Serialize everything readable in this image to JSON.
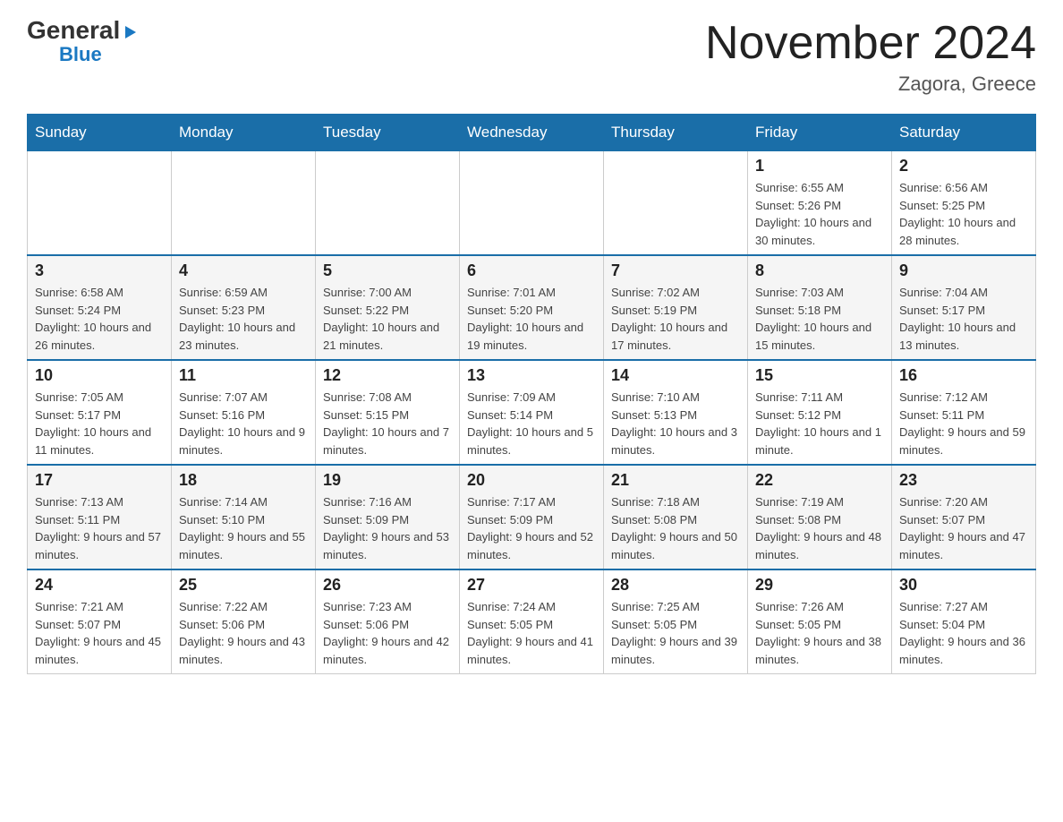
{
  "logo": {
    "general": "General",
    "triangle": "▶",
    "blue": "Blue"
  },
  "header": {
    "month": "November 2024",
    "location": "Zagora, Greece"
  },
  "weekdays": [
    "Sunday",
    "Monday",
    "Tuesday",
    "Wednesday",
    "Thursday",
    "Friday",
    "Saturday"
  ],
  "weeks": [
    [
      {
        "day": "",
        "info": ""
      },
      {
        "day": "",
        "info": ""
      },
      {
        "day": "",
        "info": ""
      },
      {
        "day": "",
        "info": ""
      },
      {
        "day": "",
        "info": ""
      },
      {
        "day": "1",
        "info": "Sunrise: 6:55 AM\nSunset: 5:26 PM\nDaylight: 10 hours and 30 minutes."
      },
      {
        "day": "2",
        "info": "Sunrise: 6:56 AM\nSunset: 5:25 PM\nDaylight: 10 hours and 28 minutes."
      }
    ],
    [
      {
        "day": "3",
        "info": "Sunrise: 6:58 AM\nSunset: 5:24 PM\nDaylight: 10 hours and 26 minutes."
      },
      {
        "day": "4",
        "info": "Sunrise: 6:59 AM\nSunset: 5:23 PM\nDaylight: 10 hours and 23 minutes."
      },
      {
        "day": "5",
        "info": "Sunrise: 7:00 AM\nSunset: 5:22 PM\nDaylight: 10 hours and 21 minutes."
      },
      {
        "day": "6",
        "info": "Sunrise: 7:01 AM\nSunset: 5:20 PM\nDaylight: 10 hours and 19 minutes."
      },
      {
        "day": "7",
        "info": "Sunrise: 7:02 AM\nSunset: 5:19 PM\nDaylight: 10 hours and 17 minutes."
      },
      {
        "day": "8",
        "info": "Sunrise: 7:03 AM\nSunset: 5:18 PM\nDaylight: 10 hours and 15 minutes."
      },
      {
        "day": "9",
        "info": "Sunrise: 7:04 AM\nSunset: 5:17 PM\nDaylight: 10 hours and 13 minutes."
      }
    ],
    [
      {
        "day": "10",
        "info": "Sunrise: 7:05 AM\nSunset: 5:17 PM\nDaylight: 10 hours and 11 minutes."
      },
      {
        "day": "11",
        "info": "Sunrise: 7:07 AM\nSunset: 5:16 PM\nDaylight: 10 hours and 9 minutes."
      },
      {
        "day": "12",
        "info": "Sunrise: 7:08 AM\nSunset: 5:15 PM\nDaylight: 10 hours and 7 minutes."
      },
      {
        "day": "13",
        "info": "Sunrise: 7:09 AM\nSunset: 5:14 PM\nDaylight: 10 hours and 5 minutes."
      },
      {
        "day": "14",
        "info": "Sunrise: 7:10 AM\nSunset: 5:13 PM\nDaylight: 10 hours and 3 minutes."
      },
      {
        "day": "15",
        "info": "Sunrise: 7:11 AM\nSunset: 5:12 PM\nDaylight: 10 hours and 1 minute."
      },
      {
        "day": "16",
        "info": "Sunrise: 7:12 AM\nSunset: 5:11 PM\nDaylight: 9 hours and 59 minutes."
      }
    ],
    [
      {
        "day": "17",
        "info": "Sunrise: 7:13 AM\nSunset: 5:11 PM\nDaylight: 9 hours and 57 minutes."
      },
      {
        "day": "18",
        "info": "Sunrise: 7:14 AM\nSunset: 5:10 PM\nDaylight: 9 hours and 55 minutes."
      },
      {
        "day": "19",
        "info": "Sunrise: 7:16 AM\nSunset: 5:09 PM\nDaylight: 9 hours and 53 minutes."
      },
      {
        "day": "20",
        "info": "Sunrise: 7:17 AM\nSunset: 5:09 PM\nDaylight: 9 hours and 52 minutes."
      },
      {
        "day": "21",
        "info": "Sunrise: 7:18 AM\nSunset: 5:08 PM\nDaylight: 9 hours and 50 minutes."
      },
      {
        "day": "22",
        "info": "Sunrise: 7:19 AM\nSunset: 5:08 PM\nDaylight: 9 hours and 48 minutes."
      },
      {
        "day": "23",
        "info": "Sunrise: 7:20 AM\nSunset: 5:07 PM\nDaylight: 9 hours and 47 minutes."
      }
    ],
    [
      {
        "day": "24",
        "info": "Sunrise: 7:21 AM\nSunset: 5:07 PM\nDaylight: 9 hours and 45 minutes."
      },
      {
        "day": "25",
        "info": "Sunrise: 7:22 AM\nSunset: 5:06 PM\nDaylight: 9 hours and 43 minutes."
      },
      {
        "day": "26",
        "info": "Sunrise: 7:23 AM\nSunset: 5:06 PM\nDaylight: 9 hours and 42 minutes."
      },
      {
        "day": "27",
        "info": "Sunrise: 7:24 AM\nSunset: 5:05 PM\nDaylight: 9 hours and 41 minutes."
      },
      {
        "day": "28",
        "info": "Sunrise: 7:25 AM\nSunset: 5:05 PM\nDaylight: 9 hours and 39 minutes."
      },
      {
        "day": "29",
        "info": "Sunrise: 7:26 AM\nSunset: 5:05 PM\nDaylight: 9 hours and 38 minutes."
      },
      {
        "day": "30",
        "info": "Sunrise: 7:27 AM\nSunset: 5:04 PM\nDaylight: 9 hours and 36 minutes."
      }
    ]
  ]
}
